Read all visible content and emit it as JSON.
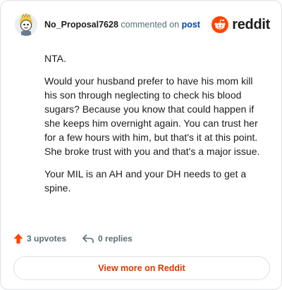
{
  "header": {
    "username": "No_Proposal7628",
    "action_text": "commented on",
    "post_link_label": "post",
    "brand_name": "reddit",
    "avatar_icon": "avatar-icon",
    "brand_icon": "reddit-logo-icon"
  },
  "comment": {
    "paragraphs": [
      "NTA.",
      "Would your husband prefer to have his mom kill his son through neglecting to check his blood sugars? Because you know that could happen if she keeps him overnight again. You can trust her for a few hours with him, but that's it at this point. She broke trust with you and that's a major issue.",
      "Your MIL is an AH and your DH needs to get a spine."
    ]
  },
  "footer": {
    "upvotes_label": "3 upvotes",
    "replies_label": "0 replies",
    "upvote_icon": "upvote-arrow-icon",
    "reply_icon": "reply-arrow-icon"
  },
  "cta": {
    "label": "View more on Reddit"
  },
  "colors": {
    "accent": "#ff4500",
    "cta_text": "#d93a00",
    "link": "#0045ac",
    "muted": "#576f76",
    "border": "#dde0e3"
  }
}
